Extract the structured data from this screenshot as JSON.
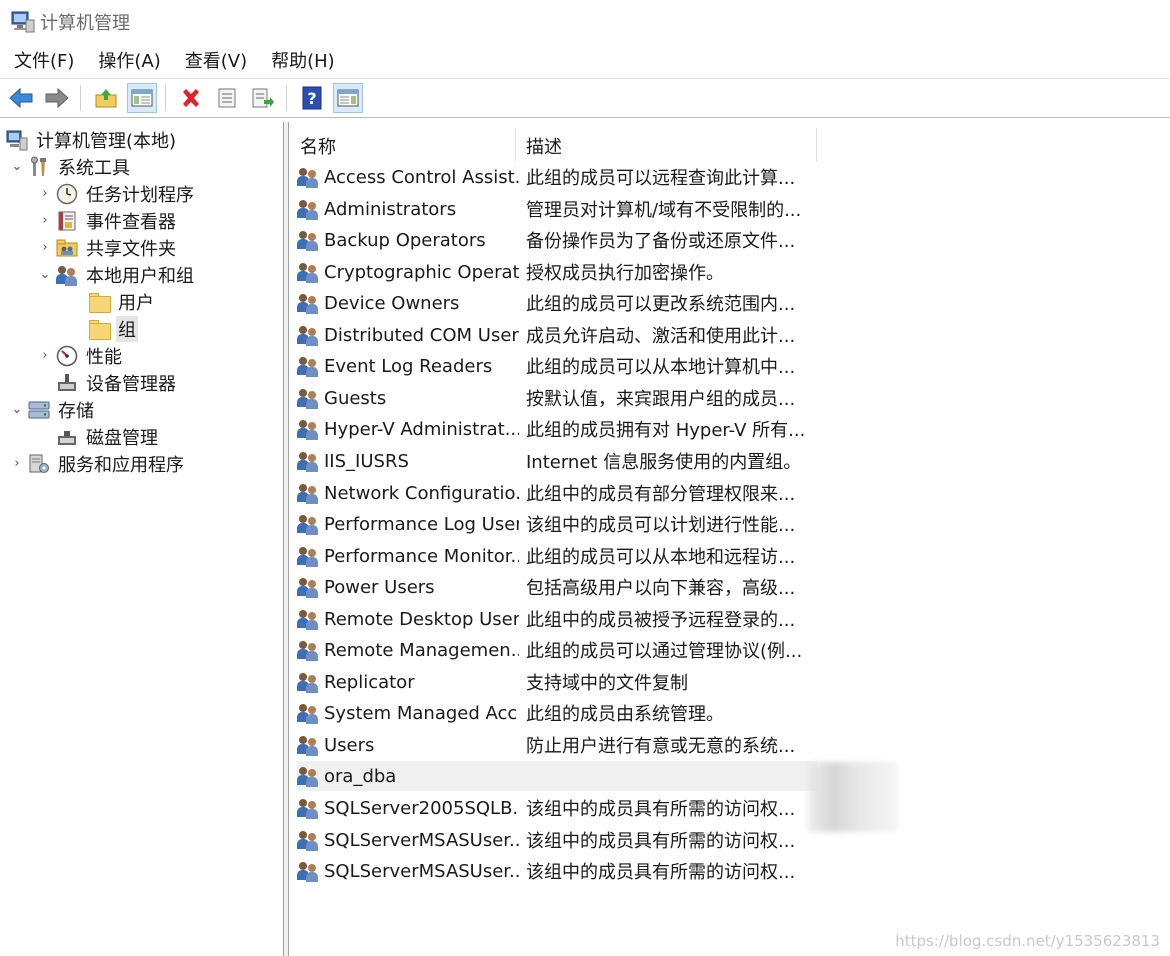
{
  "window": {
    "title": "计算机管理"
  },
  "menu": [
    "文件(F)",
    "操作(A)",
    "查看(V)",
    "帮助(H)"
  ],
  "toolbar": {
    "icons": [
      "back-arrow-icon",
      "forward-arrow-icon",
      "up-folder-icon",
      "show-hide-tree-icon",
      "delete-icon",
      "properties-icon",
      "export-list-icon",
      "help-icon",
      "show-hide-action-pane-icon"
    ]
  },
  "tree": [
    {
      "label": "计算机管理(本地)",
      "icon": "computer-management-icon",
      "chevron": ""
    },
    {
      "label": "系统工具",
      "icon": "system-tools-icon",
      "chevron": "⌄"
    },
    {
      "label": "任务计划程序",
      "icon": "task-scheduler-icon",
      "chevron": "›"
    },
    {
      "label": "事件查看器",
      "icon": "event-viewer-icon",
      "chevron": "›"
    },
    {
      "label": "共享文件夹",
      "icon": "shared-folders-icon",
      "chevron": "›"
    },
    {
      "label": "本地用户和组",
      "icon": "local-users-groups-icon",
      "chevron": "⌄"
    },
    {
      "label": "用户",
      "icon": "folder-icon",
      "chevron": ""
    },
    {
      "label": "组",
      "icon": "folder-icon",
      "chevron": "",
      "selected": true
    },
    {
      "label": "性能",
      "icon": "performance-icon",
      "chevron": "›"
    },
    {
      "label": "设备管理器",
      "icon": "device-manager-icon",
      "chevron": ""
    },
    {
      "label": "存储",
      "icon": "storage-icon",
      "chevron": "⌄"
    },
    {
      "label": "磁盘管理",
      "icon": "disk-management-icon",
      "chevron": ""
    },
    {
      "label": "服务和应用程序",
      "icon": "services-applications-icon",
      "chevron": "›"
    }
  ],
  "list": {
    "columns": [
      "名称",
      "描述"
    ],
    "rows": [
      {
        "name": "Access Control Assist...",
        "desc": "此组的成员可以远程查询此计算..."
      },
      {
        "name": "Administrators",
        "desc": "管理员对计算机/域有不受限制的..."
      },
      {
        "name": "Backup Operators",
        "desc": "备份操作员为了备份或还原文件..."
      },
      {
        "name": "Cryptographic Operat...",
        "desc": "授权成员执行加密操作。"
      },
      {
        "name": "Device Owners",
        "desc": "此组的成员可以更改系统范围内..."
      },
      {
        "name": "Distributed COM Users",
        "desc": "成员允许启动、激活和使用此计..."
      },
      {
        "name": "Event Log Readers",
        "desc": "此组的成员可以从本地计算机中..."
      },
      {
        "name": "Guests",
        "desc": "按默认值，来宾跟用户组的成员..."
      },
      {
        "name": "Hyper-V Administrat...",
        "desc": "此组的成员拥有对 Hyper-V 所有..."
      },
      {
        "name": "IIS_IUSRS",
        "desc": "Internet 信息服务使用的内置组。"
      },
      {
        "name": "Network Configuratio...",
        "desc": "此组中的成员有部分管理权限来..."
      },
      {
        "name": "Performance Log Users",
        "desc": "该组中的成员可以计划进行性能..."
      },
      {
        "name": "Performance Monitor...",
        "desc": "此组的成员可以从本地和远程访..."
      },
      {
        "name": "Power Users",
        "desc": "包括高级用户以向下兼容，高级..."
      },
      {
        "name": "Remote Desktop Users",
        "desc": "此组中的成员被授予远程登录的..."
      },
      {
        "name": "Remote Managemen...",
        "desc": "此组的成员可以通过管理协议(例..."
      },
      {
        "name": "Replicator",
        "desc": "支持域中的文件复制"
      },
      {
        "name": "System Managed Acc...",
        "desc": "此组的成员由系统管理。"
      },
      {
        "name": "Users",
        "desc": "防止用户进行有意或无意的系统..."
      },
      {
        "name": "ora_dba",
        "desc": "",
        "highlighted": true
      },
      {
        "name": "SQLServer2005SQLB...",
        "desc": "该组中的成员具有所需的访问权..."
      },
      {
        "name": "SQLServerMSASUser...",
        "desc": "该组中的成员具有所需的访问权..."
      },
      {
        "name": "SQLServerMSASUser...",
        "desc": "该组中的成员具有所需的访问权..."
      }
    ]
  },
  "watermark": "https://blog.csdn.net/y1535623813"
}
